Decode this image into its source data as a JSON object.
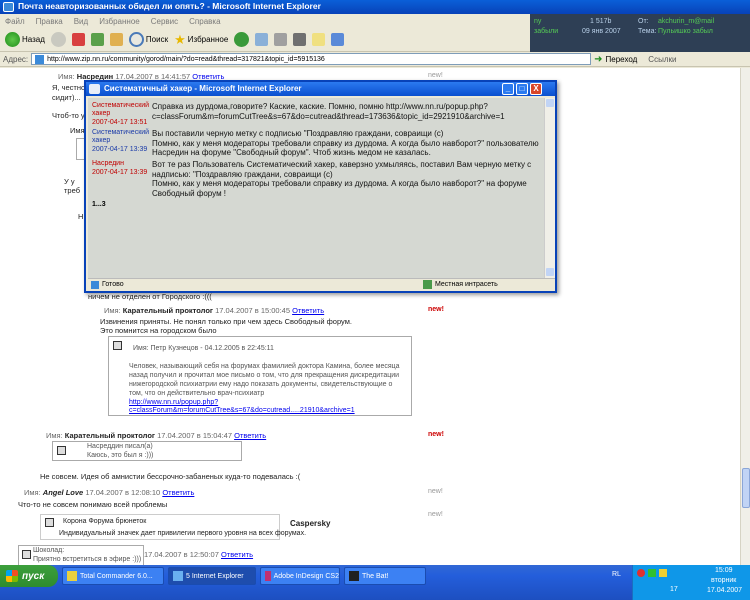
{
  "window": {
    "title": "Почта неавторизованных обидел ли опять? - Microsoft Internet Explorer"
  },
  "menu": [
    "Файл",
    "Правка",
    "Вид",
    "Избранное",
    "Сервис",
    "Справка"
  ],
  "toolbar": {
    "back": "Назад",
    "search": "Поиск",
    "favorites": "Избранное"
  },
  "info_panel": {
    "line1_left": "nу",
    "line1_mid": "1 517b",
    "line1_right": "От:",
    "line1_val": "akchurin_m@mail",
    "line2_left": "забыли",
    "line2_mid": "09 янв 2007",
    "line2_right": "Тема:",
    "line2_val": "Пульишко забыл"
  },
  "address": {
    "label": "Адрес:",
    "url": "http://www.zip.nn.ru/community/gorod/main/?do=read&thread=317821&topic_id=5915136",
    "go": "Переход",
    "links": "Ссылки"
  },
  "content": {
    "top_name_label": "Имя:",
    "top_name": "Насредин",
    "top_meta": "17.04.2007 в 14:41:57",
    "top_reply": "Ответить",
    "top_line1": "Я, честно",
    "top_line2": "сидит)...",
    "top_line3": "Чтоб-то у",
    "side_name1": "Имя:",
    "side_text1": "Нас",
    "side_text2": "У у",
    "side_text3": "треб",
    "side_text4": "Имя:",
    "side_text5": "Пом",
    "side_text6": "У у",
    "side_text7": "треба",
    "side_text8": "Н",
    "below_popup": "ничем не отделен от Городского :(((",
    "post1_label": "Имя:",
    "post1_author": "Карательный проктолог",
    "post1_meta": "17.04.2007 в 15:00:45",
    "post1_reply": "Ответить",
    "post1_new": "new!",
    "post1_l1": "Извинения приняты. Не понял только при чем здесь Свободный форум.",
    "post1_l2": "Это помнится на городском было",
    "quote1_head": "Имя: Петр Кузнецов - 04.12.2005 в 22:45:11",
    "quote1_l1": "Человек, называющий себя на форумах фамилией доктора Камина, более месяца",
    "quote1_l2": "назад получил и прочитал мое письмо о том, что для прекращения дискредитации",
    "quote1_l3": "нижегородской психиатрии ему надо показать документы, свидетельствующие о",
    "quote1_l4": "том, что он действительно врач-психиатр",
    "quote1_link1": "http://www.nn.ru/popup.php?",
    "quote1_link2": "c=classForum&m=forumCutTree&s=67&do=cutread.....21910&archive=1",
    "post2_label": "Имя:",
    "post2_author": "Карательный проктолог",
    "post2_meta": "17.04.2007 в 15:04:47",
    "post2_reply": "Ответить",
    "post2_new": "new!",
    "quote2_l1": "Насреддин писал(а)",
    "quote2_l2": "Каюсь, это был я :)))",
    "post2_text": "Не совсем. Идея об амнистии бессрочно-забаненых куда-то подевалась :(",
    "post3_label": "Имя:",
    "post3_author": "Angel Love",
    "post3_meta": "17.04.2007 в 12:08:10",
    "post3_reply": "Ответить",
    "post3_new": "new!",
    "post3_text": "Что-то не совсем понимаю всей проблемы",
    "post4_new": "new!",
    "crown_title": "Корона Форума брюнеток",
    "crown_desc": "Индивидуальный значек дает привилегии первого уровня на всех форумах.",
    "kaspersky": "Caspersky",
    "post5_label": "Шоколад:",
    "post5_sub": "Приятно встретиться в эфире :)))",
    "post5_meta": "17.04.2007 в 12:50:07",
    "post5_reply": "Ответить"
  },
  "popup": {
    "title": "Систематичный хакер - Microsoft Internet Explorer",
    "min": "_",
    "max": "□",
    "close": "X",
    "msgs": [
      {
        "author1": "Систематический",
        "author2": "хакер",
        "date": "2007-04-17 13:51",
        "lines": [
          "Справка из дурдома,говорите? Каские, каские. Помню, помню http://www.nn.ru/popup.php?",
          "c=classForum&m=forumCutTree&s=67&do=cutread&thread=173636&topic_id=2921910&archive=1"
        ]
      },
      {
        "author1": "Систематический",
        "author2": "хакер",
        "date": "2007-04-17 13:39",
        "lines": [
          "Вы поставили черную метку с подписью \"Поздравляю граждани, совраищи (с)",
          "Помню, как у меня модераторы требовали справку из дурдома. А когда было навборот?\" пользователю",
          "Насредин на форуме \"Свободный форум\". Чтоб жизнь медом не казалась."
        ]
      },
      {
        "author1": "Насредин",
        "author2": "",
        "date": "2007-04-17 13:39",
        "lines": [
          "Вот те раз Пользователь Систематический хакер, каверзно ухмыляясь, поставил Вам черную метку с",
          "надписью: \"Поздравляю граждани, совраищи (с)",
          "Помню, как у меня модераторы требовали справку из дурдома. А когда было навборот?\" на форуме",
          "Свободный форум !"
        ]
      }
    ],
    "pager": "1...3",
    "status_left": "Готово",
    "status_right": "Местная интрасеть"
  },
  "taskbar": {
    "start": "пуск",
    "tasks": [
      "Total Commander 6.0...",
      "5 Internet Explorer",
      "Adobe InDesign CS2",
      "The Bat!"
    ],
    "lang": "RL",
    "time": "15:09",
    "day": "вторник",
    "date": "17.04.2007",
    "tray_num": "17"
  },
  "colors": {
    "xp_blue": "#0a5fd8",
    "author_red": "#c00000",
    "author_blue": "#1a3aa8",
    "link": "#0000ee"
  }
}
